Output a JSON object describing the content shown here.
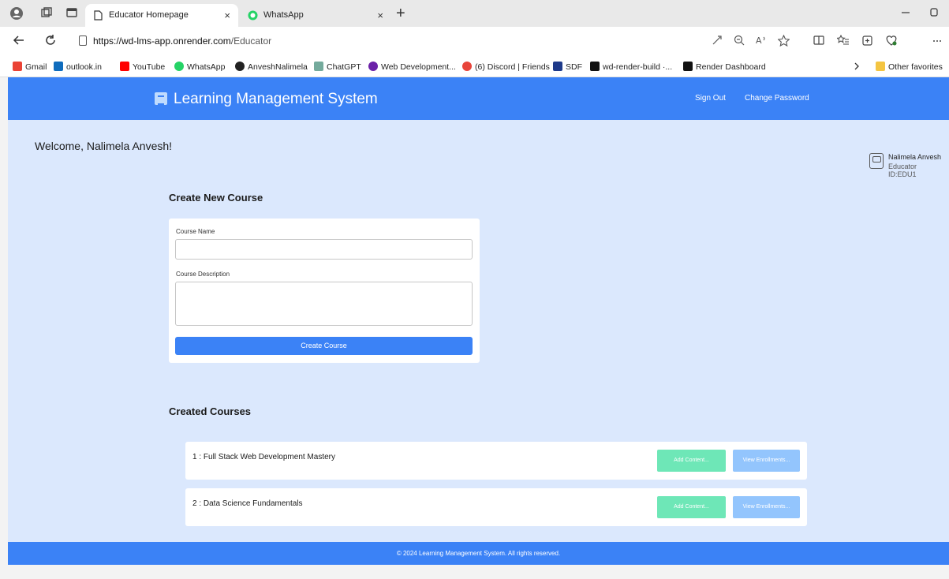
{
  "browser": {
    "tabs": [
      {
        "title": "Educator Homepage",
        "active": true
      },
      {
        "title": "WhatsApp",
        "active": false
      }
    ],
    "close_glyph": "×",
    "new_tab_glyph": "+",
    "url_domain": "https://wd-lms-app.onrender.com",
    "url_path": "/Educator",
    "bookmarks": [
      {
        "label": "Gmail",
        "color": "#ea4335"
      },
      {
        "label": "outlook.in",
        "color": "#0f6cbd"
      },
      {
        "label": "YouTube",
        "color": "#ff0000"
      },
      {
        "label": "WhatsApp",
        "color": "#25d366"
      },
      {
        "label": "AnveshNalimela",
        "color": "#222222"
      },
      {
        "label": "ChatGPT",
        "color": "#74aa9c"
      },
      {
        "label": "Web Development...",
        "color": "#6b21a8"
      },
      {
        "label": "(6) Discord | Friends",
        "color": "#e8443a"
      },
      {
        "label": "SDF",
        "color": "#1e3a8a"
      },
      {
        "label": "wd-render-build ·...",
        "color": "#111111"
      },
      {
        "label": "Render Dashboard",
        "color": "#111111"
      }
    ],
    "other_favorites": "Other favorites"
  },
  "header": {
    "brand": "Learning Management System",
    "sign_out": "Sign Out",
    "change_password": "Change Password"
  },
  "welcome": "Welcome, Nalimela Anvesh!",
  "profile": {
    "name": "Nalimela Anvesh",
    "educator_id": "Educator ID:EDU1"
  },
  "create_course": {
    "title": "Create New Course",
    "name_label": "Course Name",
    "name_value": "",
    "description_label": "Course Description",
    "description_value": "",
    "submit_label": "Create Course"
  },
  "created_courses": {
    "title": "Created Courses",
    "add_content_label": "Add Content...",
    "view_enrollments_label": "View Enrollments...",
    "items": [
      {
        "label": "1 : Full Stack Web Development Mastery"
      },
      {
        "label": "2 : Data Science Fundamentals"
      }
    ]
  },
  "footer": "© 2024 Learning Management System. All rights reserved.",
  "colors": {
    "primary": "#3b82f6",
    "page_bg": "#dbe8fd",
    "add_button": "#6ee7b7",
    "view_button": "#93c5fd"
  }
}
